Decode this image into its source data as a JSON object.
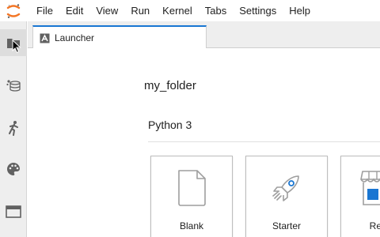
{
  "menubar": {
    "logo_icon": "jupyter-logo-icon",
    "items": [
      "File",
      "Edit",
      "View",
      "Run",
      "Kernel",
      "Tabs",
      "Settings",
      "Help"
    ]
  },
  "sidebar": {
    "items": [
      {
        "icon": "folder-icon",
        "active": true
      },
      {
        "icon": "running-kernels-icon",
        "active": false
      },
      {
        "icon": "run-icon",
        "active": false
      },
      {
        "icon": "palette-icon",
        "active": false
      },
      {
        "icon": "tabs-icon",
        "active": false
      }
    ]
  },
  "tabs": [
    {
      "label": "Launcher",
      "icon": "launcher-icon",
      "active": true
    }
  ],
  "launcher": {
    "cwd": "my_folder",
    "section_title": "Python 3",
    "cards": [
      {
        "label": "Blank",
        "icon": "blank-notebook-icon"
      },
      {
        "label": "Starter",
        "icon": "rocket-icon"
      },
      {
        "label": "Retail",
        "icon": "store-icon"
      }
    ]
  },
  "colors": {
    "accent": "#1976d2",
    "jupyter_orange": "#f37626",
    "sidebar_bg": "#eeeeee",
    "icon_gray": "#616161"
  }
}
